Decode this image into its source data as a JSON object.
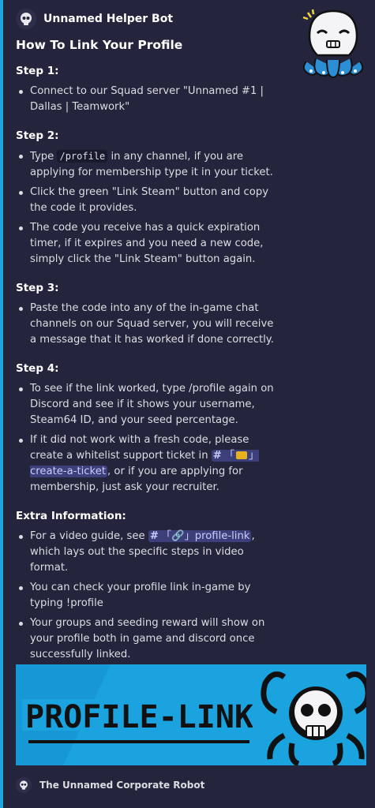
{
  "embed": {
    "author": "Unnamed Helper Bot",
    "title": "How To Link Your Profile",
    "accent": "#1ea7de",
    "step1": {
      "heading": "Step 1:",
      "items": [
        "Connect to our Squad server \"Unnamed #1 | Dallas | Teamwork\""
      ]
    },
    "step2": {
      "heading": "Step 2:",
      "item1_pre": "Type ",
      "item1_code": "/profile",
      "item1_post": " in any channel, if you are applying for membership type it in your ticket.",
      "item2": "Click the green \"Link Steam\" button and copy the code it provides.",
      "item3": "The code you receive has a quick expiration timer, if it expires and you need a new code, simply click the \"Link Steam\" button again."
    },
    "step3": {
      "heading": "Step 3:",
      "item1": "Paste the code into any of the in-game chat channels on our Squad server, you will receive a message that it has worked if done correctly."
    },
    "step4": {
      "heading": "Step 4:",
      "item1": "To see if the link worked, type /profile again on Discord and see if it shows your username, Steam64 ID, and your seed percentage.",
      "item2_pre": "If it did not work with a fresh code, please create a whitelist support ticket in ",
      "item2_channel": "create-a-ticket",
      "item2_post": ", or if you are applying for membership, just ask your recruiter."
    },
    "extra": {
      "heading": "Extra Information:",
      "item1_pre": "For a video guide, see ",
      "item1_channel": "profile-link",
      "item1_post": ", which lays out the specific steps in video format.",
      "item2": "You can check your profile link in-game by typing !profile",
      "item3": "Your groups and seeding reward will show on your profile both in game and discord once successfully linked."
    },
    "channel_hash": "#",
    "bracket_open": "「",
    "bracket_close": "」",
    "link_glyph": "🔗",
    "banner_text": "PROFILE-LINK",
    "footer": "The Unnamed Corporate Robot"
  }
}
